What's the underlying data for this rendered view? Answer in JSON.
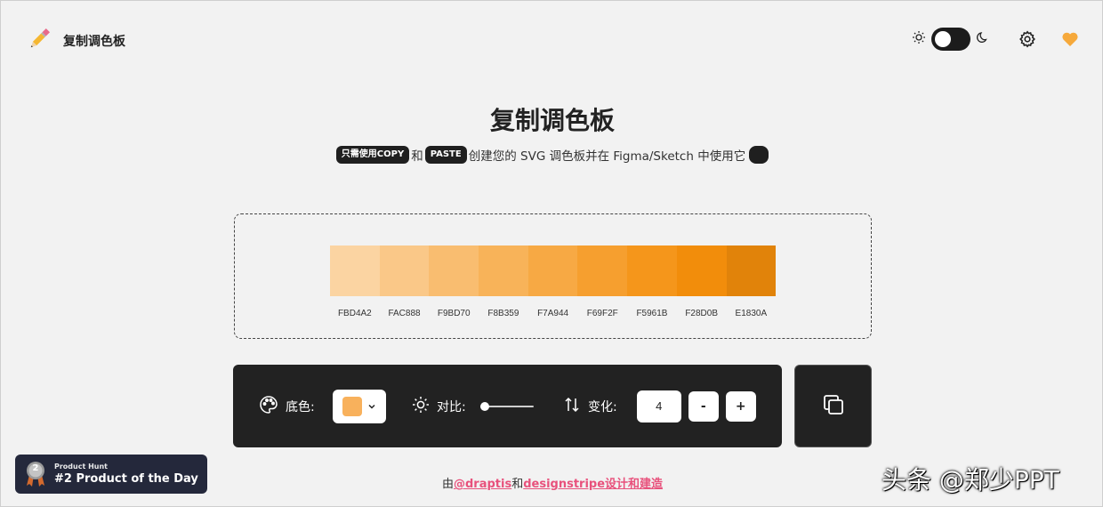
{
  "header": {
    "app_title": "复制调色板",
    "logo_icon": "pencil-icon",
    "theme": {
      "sun_icon": "sun-icon",
      "moon_icon": "moon-icon",
      "dark_mode": false
    },
    "settings_icon": "gear-icon",
    "favorite_icon": "heart-icon"
  },
  "hero": {
    "title": "复制调色板",
    "subtitle_kbd_copy": "只需使用COPY",
    "subtitle_and": "和",
    "subtitle_kbd_paste": "PASTE",
    "subtitle_rest": "创建您的 SVG 调色板并在 Figma/Sketch 中使用它"
  },
  "palette": {
    "swatches": [
      {
        "code": "FBD4A2",
        "color": "#FBD4A2"
      },
      {
        "code": "FAC888",
        "color": "#FAC888"
      },
      {
        "code": "F9BD70",
        "color": "#F9BD70"
      },
      {
        "code": "F8B359",
        "color": "#F8B359"
      },
      {
        "code": "F7A944",
        "color": "#F7A944"
      },
      {
        "code": "F69F2F",
        "color": "#F69F2F"
      },
      {
        "code": "F5961B",
        "color": "#F5961B"
      },
      {
        "code": "F28D0B",
        "color": "#F28D0B"
      },
      {
        "code": "E1830A",
        "color": "#E1830A"
      }
    ]
  },
  "controls": {
    "base_color_label": "底色:",
    "base_color_value": "#F8B15C",
    "contrast_label": "对比:",
    "contrast_level": 0,
    "variation_label": "变化:",
    "variation_value": "4",
    "minus_label": "-",
    "plus_label": "+",
    "copy_icon": "copy-icon"
  },
  "footer": {
    "prefix": "由",
    "author1": "@draptis",
    "and": "和",
    "author2": "designstripe设计和建造"
  },
  "product_hunt": {
    "rank": "2",
    "small": "Product Hunt",
    "big": "#2 Product of the Day"
  },
  "watermark": "头条 @郑少PPT",
  "colors": {
    "accent": "#F8B15C",
    "dark": "#222222",
    "link": "#E8517C",
    "heart": "#F6A93B"
  }
}
